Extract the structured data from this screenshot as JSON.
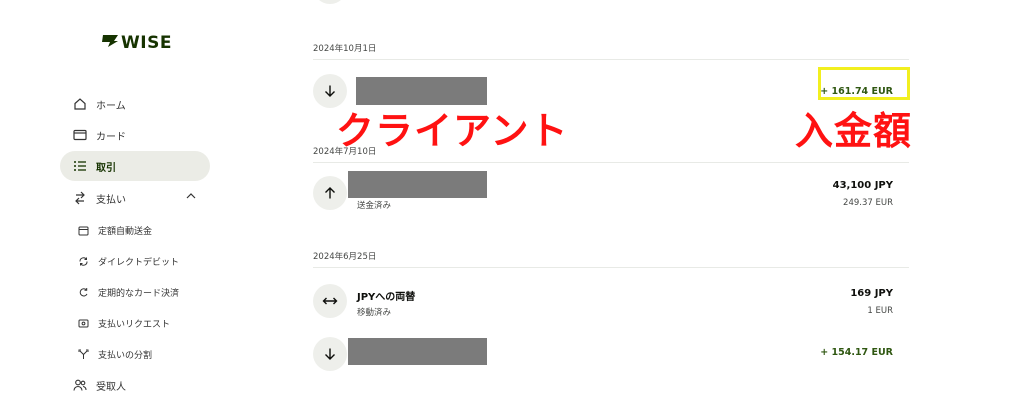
{
  "logo": {
    "mark": "ᄁ",
    "word": "WISE"
  },
  "sidebar": {
    "items": [
      {
        "label": "ホーム",
        "icon": "home-icon"
      },
      {
        "label": "カード",
        "icon": "card-icon"
      },
      {
        "label": "取引",
        "icon": "list-icon",
        "active": true
      },
      {
        "label": "支払い",
        "icon": "transfer-icon"
      }
    ],
    "subitems": [
      {
        "label": "定額自動送金",
        "icon": "calendar-icon"
      },
      {
        "label": "ダイレクトデビット",
        "icon": "refresh-icon"
      },
      {
        "label": "定期的なカード決済",
        "icon": "recurring-icon"
      },
      {
        "label": "支払いリクエスト",
        "icon": "request-icon"
      },
      {
        "label": "支払いの分割",
        "icon": "split-icon"
      }
    ],
    "recipients": {
      "label": "受取人",
      "icon": "people-icon"
    }
  },
  "transactions": {
    "groups": [
      {
        "date": "2024年10月1日",
        "rows": [
          {
            "title": "",
            "status": "",
            "amount": "+ 161.74 EUR",
            "amount_sub": "",
            "icon": "arrow-down-icon",
            "incoming": true
          }
        ]
      },
      {
        "date": "2024年7月10日",
        "rows": [
          {
            "title": "",
            "status": "送金済み",
            "amount": "43,100 JPY",
            "amount_sub": "249.37 EUR",
            "icon": "arrow-up-icon",
            "incoming": false
          }
        ]
      },
      {
        "date": "2024年6月25日",
        "rows": [
          {
            "title": "JPYへの両替",
            "status": "移動済み",
            "amount": "169 JPY",
            "amount_sub": "1 EUR",
            "icon": "exchange-icon",
            "incoming": false
          },
          {
            "title": "",
            "status": "",
            "amount": "+ 154.17 EUR",
            "amount_sub": "",
            "icon": "arrow-down-icon",
            "incoming": true
          }
        ]
      }
    ]
  },
  "annotations": {
    "client": "クライアント",
    "amount": "入金額"
  },
  "colors": {
    "brand": "#163300",
    "positive": "#2f5711",
    "annotation": "#ff1212",
    "highlight": "#f2ef1f"
  }
}
